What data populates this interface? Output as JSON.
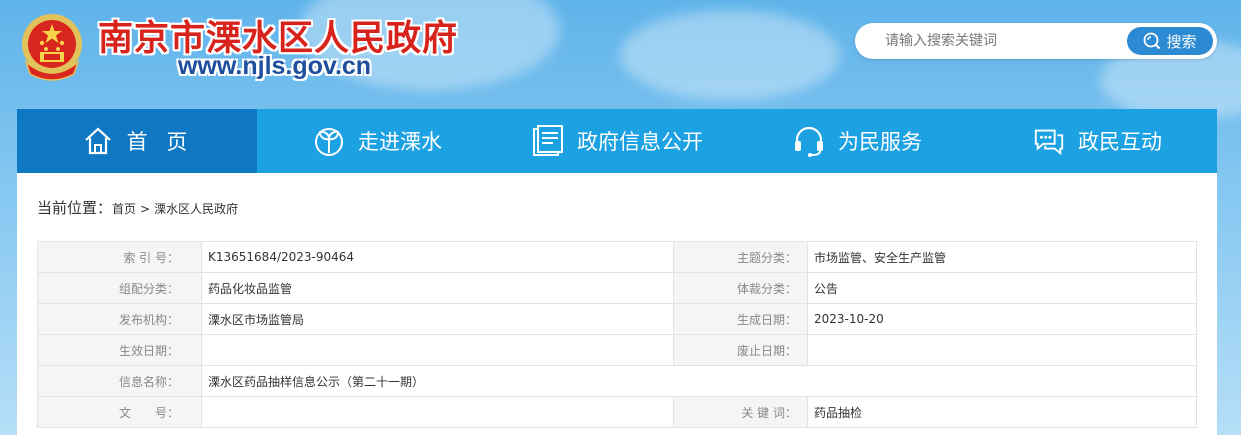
{
  "header": {
    "site_title": "南京市溧水区人民政府",
    "site_url": "www.njls.gov.cn",
    "search_placeholder": "请输入搜索关键词",
    "search_button": "搜索"
  },
  "nav": {
    "items": [
      {
        "label": "首 页",
        "icon": "home-icon",
        "active": true
      },
      {
        "label": "走进溧水",
        "icon": "leaf-icon"
      },
      {
        "label": "政府信息公开",
        "icon": "document-icon"
      },
      {
        "label": "为民服务",
        "icon": "headset-icon"
      },
      {
        "label": "政民互动",
        "icon": "chat-icon"
      }
    ]
  },
  "breadcrumb": {
    "label": "当前位置：",
    "items": [
      "首页",
      "溧水区人民政府"
    ],
    "separator": ">"
  },
  "meta": {
    "index_label": "索 引 号：",
    "index_value": "K13651684/2023-90464",
    "topic_label": "主题分类：",
    "topic_value": "市场监管、安全生产监管",
    "org_category_label": "组配分类：",
    "org_category_value": "药品化妆品监管",
    "genre_label": "体裁分类：",
    "genre_value": "公告",
    "publisher_label": "发布机构：",
    "publisher_value": "溧水区市场监管局",
    "created_label": "生成日期：",
    "created_value": "2023-10-20",
    "effective_label": "生效日期：",
    "effective_value": "",
    "abolish_label": "废止日期：",
    "abolish_value": "",
    "name_label": "信息名称：",
    "name_value": "溧水区药品抽样信息公示（第二十一期）",
    "docno_label": "文　　号：",
    "docno_value": "",
    "keywords_label": "关 键 词：",
    "keywords_value": "药品抽检"
  },
  "colors": {
    "nav_bg": "#1ca1e3",
    "nav_active_bg": "#0f78c5",
    "title_red": "#d7231c",
    "url_blue": "#1d4f9e",
    "search_button": "#2b8ad2"
  }
}
